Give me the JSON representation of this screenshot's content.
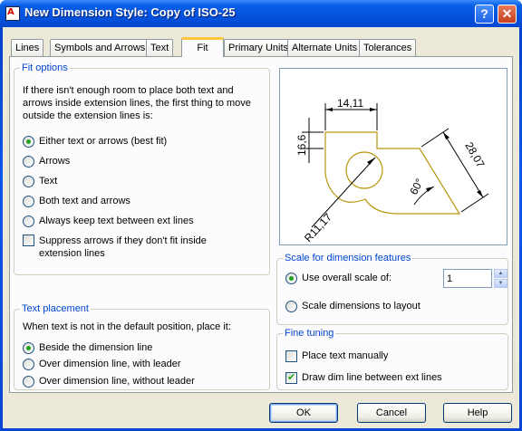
{
  "window": {
    "title": "New Dimension Style: Copy of ISO-25"
  },
  "tabs": [
    {
      "label": "Lines"
    },
    {
      "label": "Symbols and Arrows"
    },
    {
      "label": "Text"
    },
    {
      "label": "Fit"
    },
    {
      "label": "Primary Units"
    },
    {
      "label": "Alternate Units"
    },
    {
      "label": "Tolerances"
    }
  ],
  "active_tab": "Fit",
  "fit_options": {
    "title": "Fit options",
    "description": "If there isn't enough room to place both text and arrows inside extension lines, the first thing to move outside the extension lines is:",
    "options": [
      {
        "label": "Either text or arrows (best fit)",
        "selected": true
      },
      {
        "label": "Arrows",
        "selected": false
      },
      {
        "label": "Text",
        "selected": false
      },
      {
        "label": "Both text and arrows",
        "selected": false
      },
      {
        "label": "Always keep text between ext lines",
        "selected": false
      }
    ],
    "suppress_label": "Suppress arrows if they don't fit inside extension lines",
    "suppress_checked": false
  },
  "text_placement": {
    "title": "Text placement",
    "description": "When text is not in the default position, place it:",
    "options": [
      {
        "label": "Beside the dimension line",
        "selected": true
      },
      {
        "label": "Over dimension line, with leader",
        "selected": false
      },
      {
        "label": "Over dimension line, without leader",
        "selected": false
      }
    ]
  },
  "preview": {
    "dim_top": "14,11",
    "dim_left": "16,6",
    "dim_right": "28,07",
    "dim_angle": "60°",
    "dim_radius": "R11,17",
    "colors": {
      "shape": "#b8960a",
      "dims": "#000000"
    }
  },
  "scale": {
    "title": "Scale for dimension features",
    "overall_label": "Use overall scale of:",
    "overall_selected": true,
    "overall_value": "1",
    "layout_label": "Scale dimensions to layout",
    "layout_selected": false
  },
  "fine_tuning": {
    "title": "Fine tuning",
    "place_manually_label": "Place text manually",
    "place_manually_checked": false,
    "draw_dim_line_label": "Draw dim line between ext lines",
    "draw_dim_line_checked": true
  },
  "buttons": {
    "ok": "OK",
    "cancel": "Cancel",
    "help": "Help"
  },
  "colors": {
    "accent": "#0046d5",
    "selected_radio": "#21a121",
    "tab_highlight": "#ffc83c"
  }
}
